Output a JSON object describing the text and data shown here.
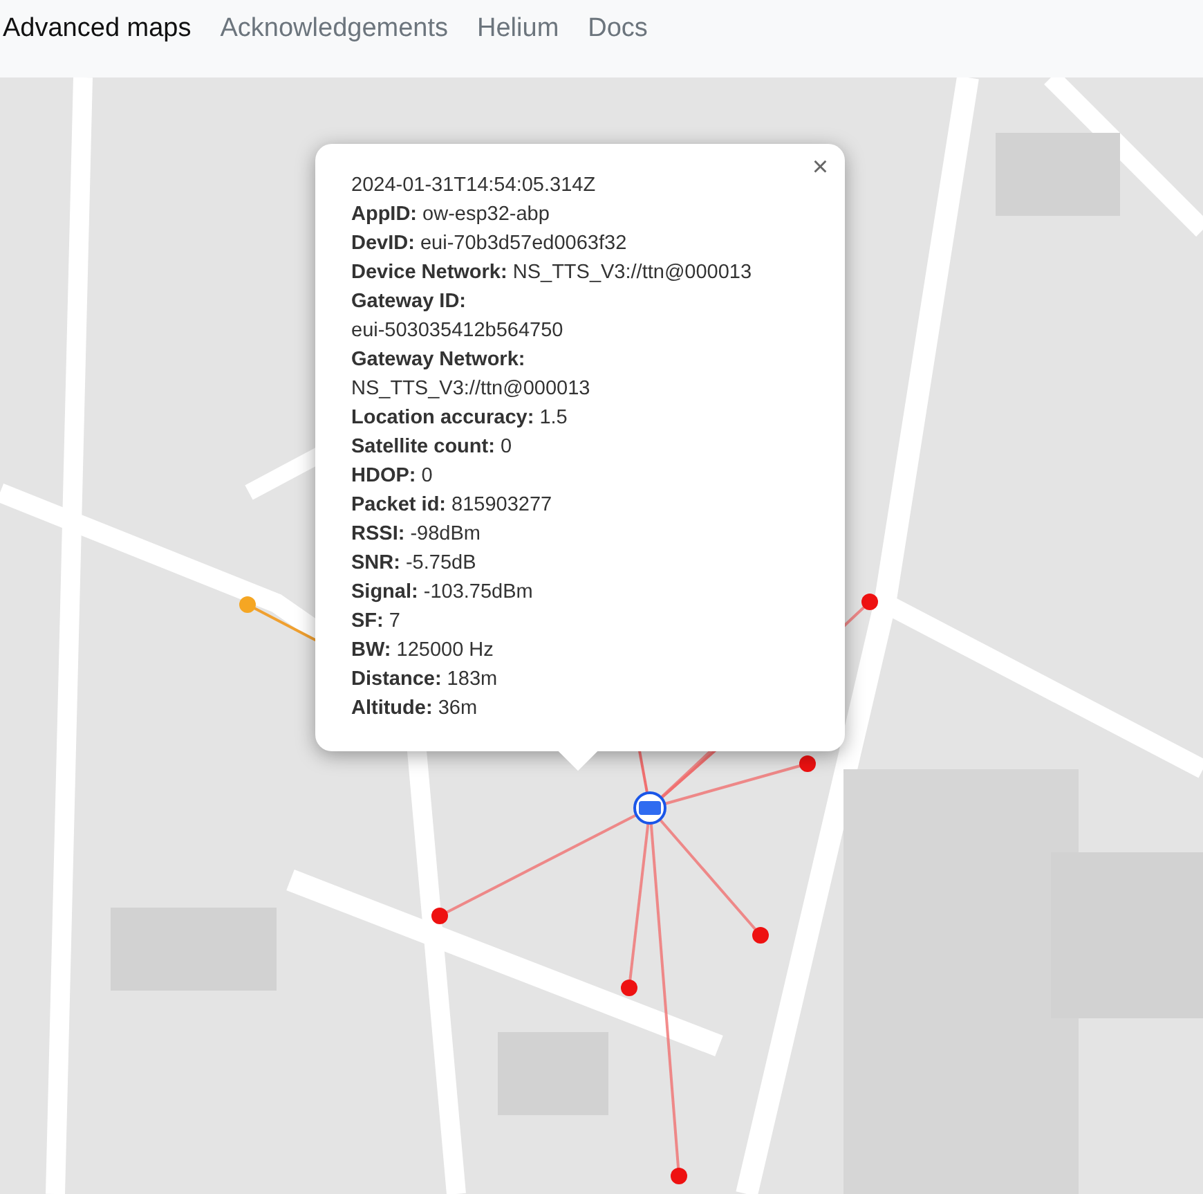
{
  "nav": {
    "items": [
      {
        "label": "Advanced maps",
        "selected": true
      },
      {
        "label": "Acknowledgements",
        "selected": false
      },
      {
        "label": "Helium",
        "selected": false
      },
      {
        "label": "Docs",
        "selected": false
      }
    ]
  },
  "popup": {
    "close": "×",
    "lines": [
      "2024-01-31T14:54:05.314Z",
      "**AppID:** ow-esp32-abp",
      "**DevID:** eui-70b3d57ed0063f32",
      "**Device Network:** NS_TTS_V3://ttn@000013",
      "**Gateway ID:**",
      "eui-503035412b564750",
      "**Gateway Network:**",
      "NS_TTS_V3://ttn@000013",
      "**Location accuracy:** 1.5",
      "**Satellite count:** 0",
      "**HDOP:** 0",
      "**Packet id:** 815903277",
      "**RSSI:** -98dBm",
      "**SNR:** -5.75dB",
      "**Signal:** -103.75dBm",
      "**SF:** 7",
      "**BW:** 125000 Hz",
      "**Distance:** 183m",
      "**Altitude:** 36m"
    ]
  }
}
